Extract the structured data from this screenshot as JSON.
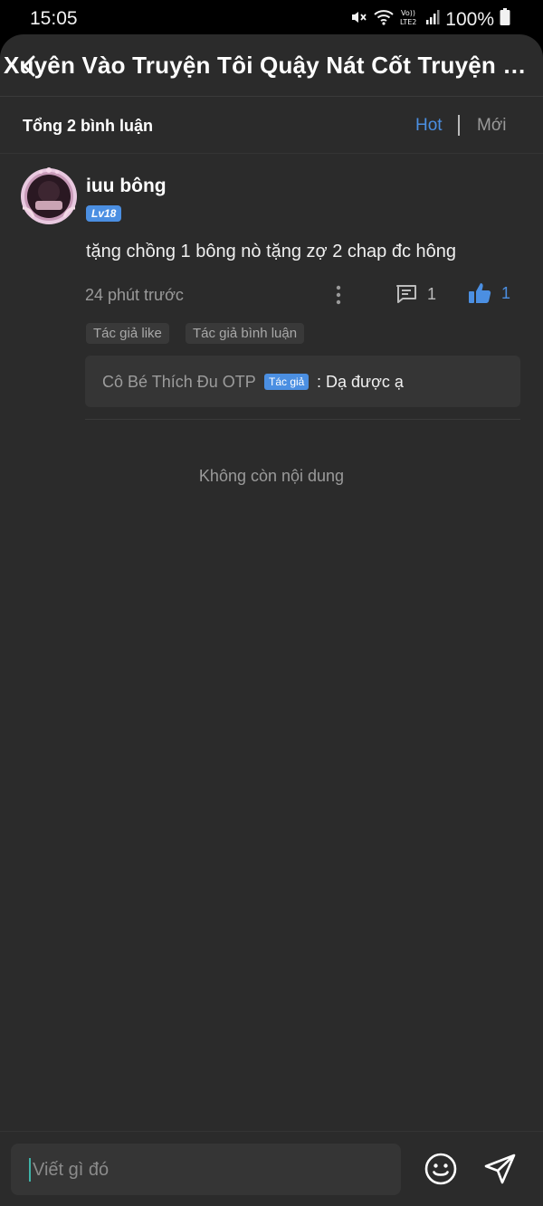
{
  "status_bar": {
    "time": "15:05",
    "battery": "100%",
    "icons": [
      "mute-icon",
      "wifi-icon",
      "volte-lte2-icon",
      "signal-icon",
      "battery-icon"
    ]
  },
  "header": {
    "title": "Xuyên Vào Truyện Tôi Quậy Nát Cốt Truyện Ch..."
  },
  "comments_header": {
    "total": "Tổng 2 bình luận",
    "sort_hot": "Hot",
    "sort_new": "Mới"
  },
  "comment": {
    "username": "iuu bông",
    "level": "Lv18",
    "text": "tặng chồng 1 bông nò tặng zợ 2 chap đc hông",
    "time_ago": "24 phút trước",
    "reply_count": "1",
    "like_count": "1",
    "tags": [
      "Tác giả like",
      "Tác giả bình luận"
    ],
    "reply": {
      "author": "Cô Bé Thích Đu OTP",
      "badge": "Tác giả",
      "colon": ":",
      "text": "Dạ được ạ"
    }
  },
  "empty_text": "Không còn nội dung",
  "input": {
    "placeholder": "Viết gì đó"
  },
  "colors": {
    "accent": "#4b8fe2",
    "background": "#2b2b2b",
    "caret": "#3fb3a8"
  }
}
